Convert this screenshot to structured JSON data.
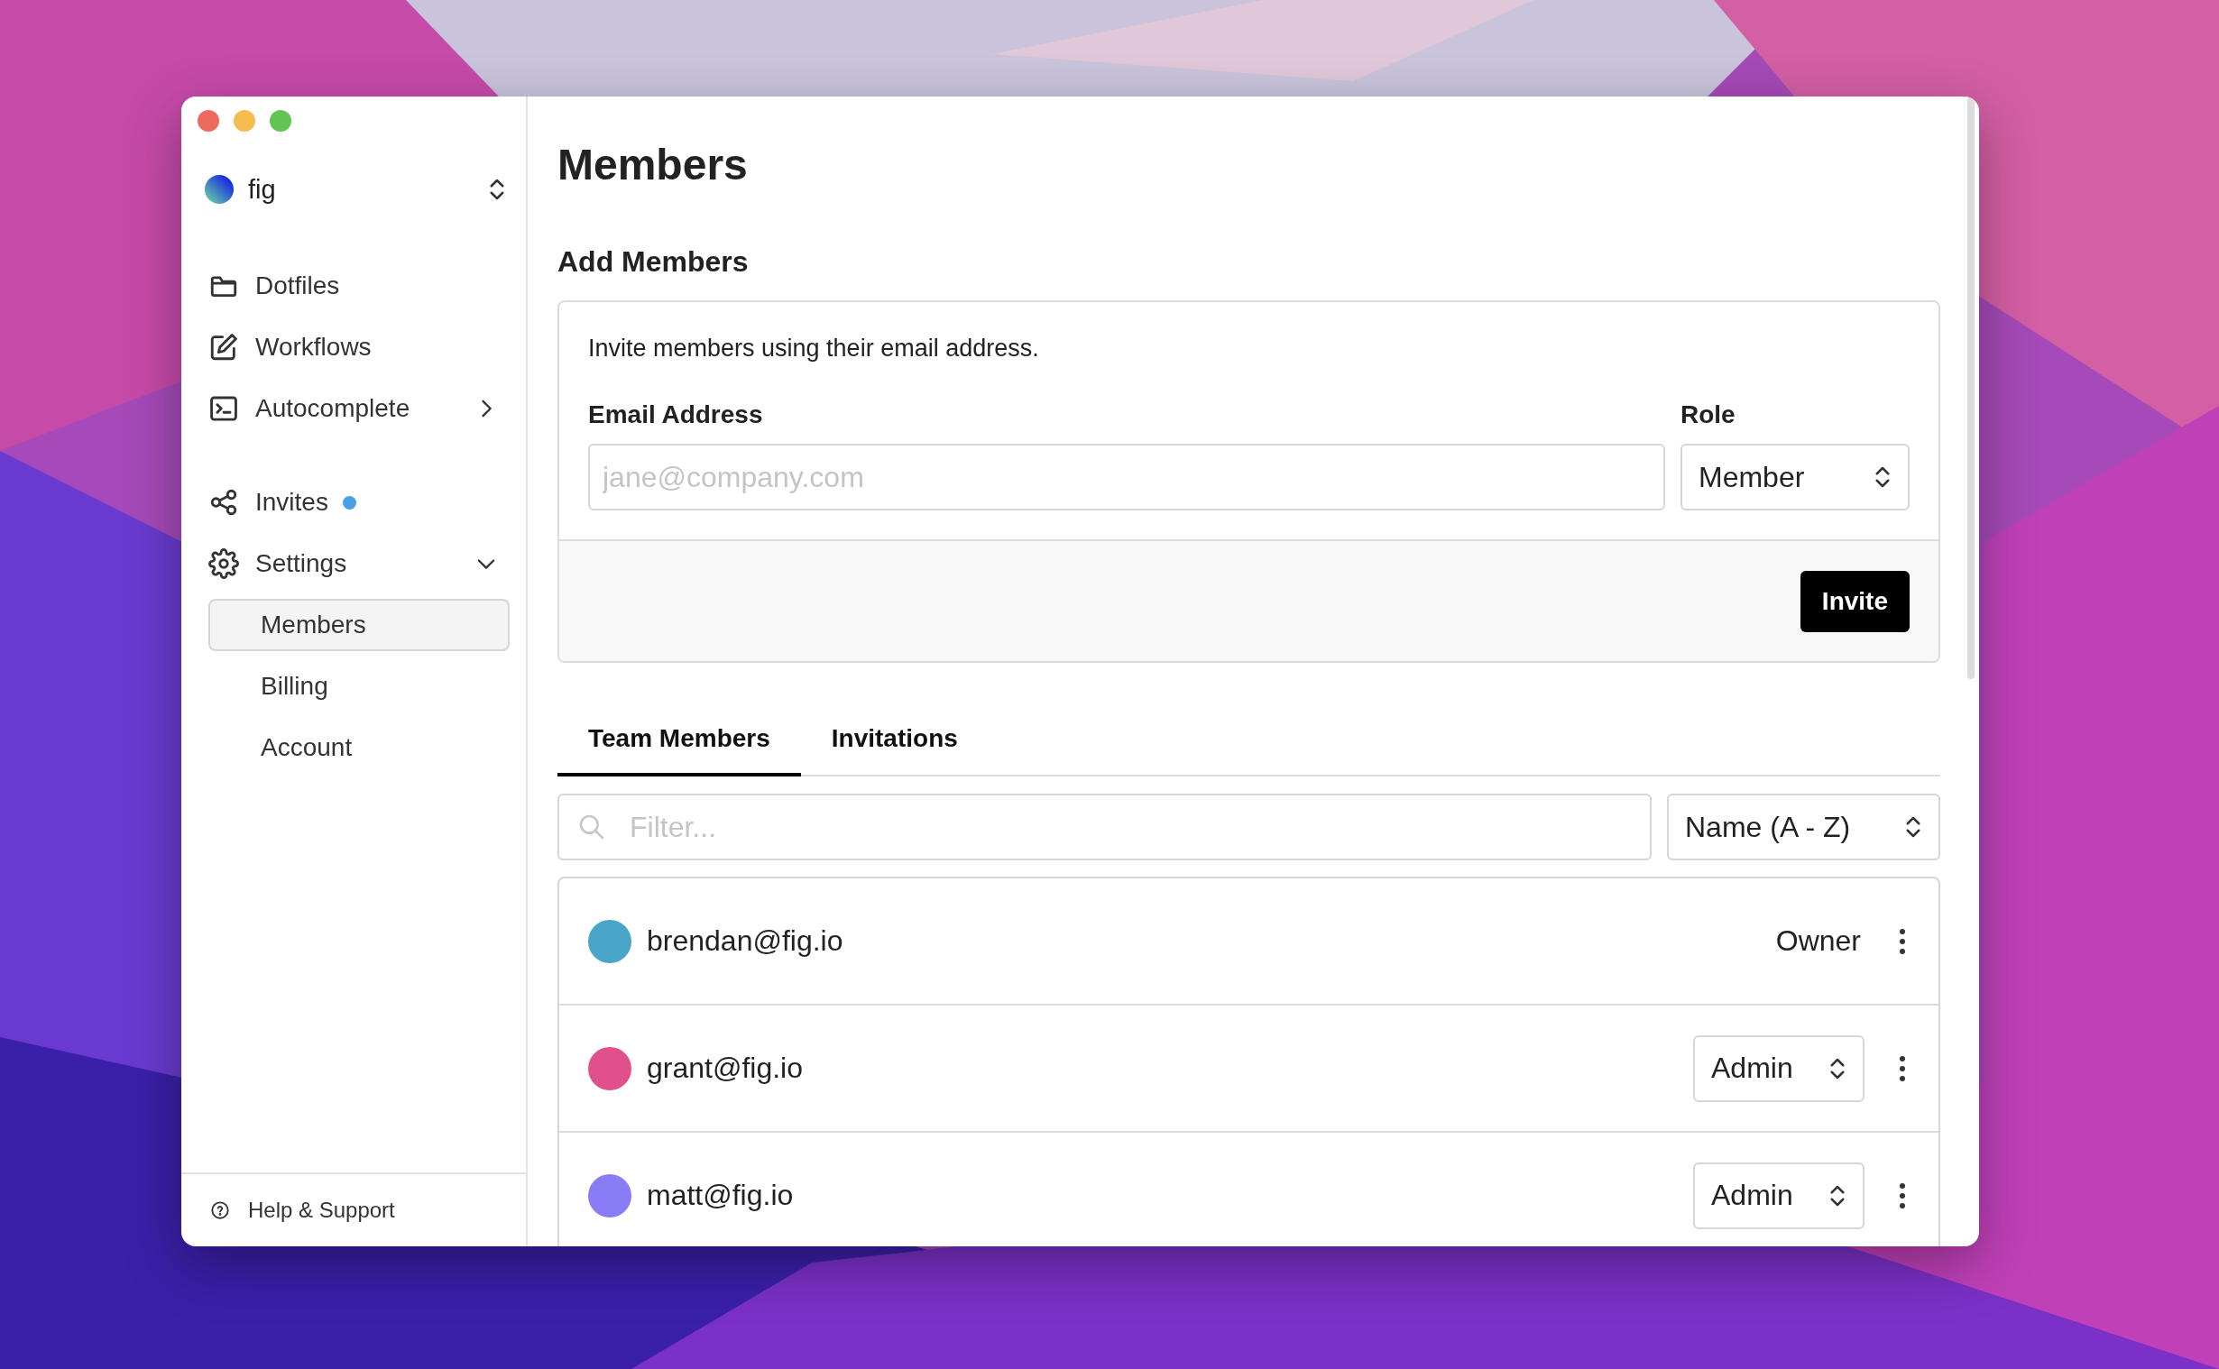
{
  "workspace": {
    "name": "fig"
  },
  "sidebar": {
    "groups": [
      {
        "items": [
          {
            "label": "Dotfiles"
          },
          {
            "label": "Workflows"
          },
          {
            "label": "Autocomplete",
            "expanded": false
          }
        ]
      },
      {
        "items": [
          {
            "label": "Invites",
            "unread": true
          },
          {
            "label": "Settings",
            "expanded": true,
            "children": [
              {
                "label": "Members",
                "selected": true
              },
              {
                "label": "Billing",
                "selected": false
              },
              {
                "label": "Account",
                "selected": false
              }
            ]
          }
        ]
      }
    ],
    "footer": {
      "label": "Help & Support"
    }
  },
  "main": {
    "title": "Members",
    "add_members": {
      "heading": "Add Members",
      "description": "Invite members using their email address.",
      "email_field": {
        "label": "Email Address",
        "placeholder": "jane@company.com"
      },
      "role_field": {
        "label": "Role",
        "value": "Member"
      },
      "submit": "Invite"
    },
    "tabs": [
      {
        "label": "Team Members",
        "selected": true
      },
      {
        "label": "Invitations",
        "selected": false
      }
    ],
    "filter": {
      "placeholder": "Filter..."
    },
    "sort": {
      "value": "Name (A - Z)"
    },
    "members": [
      {
        "email": "brendan@fig.io",
        "role": "Owner",
        "kind": "fixed",
        "color": "#4aa6c9"
      },
      {
        "email": "grant@fig.io",
        "role": "Admin",
        "kind": "select",
        "color": "#e0508a"
      },
      {
        "email": "matt@fig.io",
        "role": "Admin",
        "kind": "select",
        "color": "#8a7cf5"
      }
    ]
  }
}
